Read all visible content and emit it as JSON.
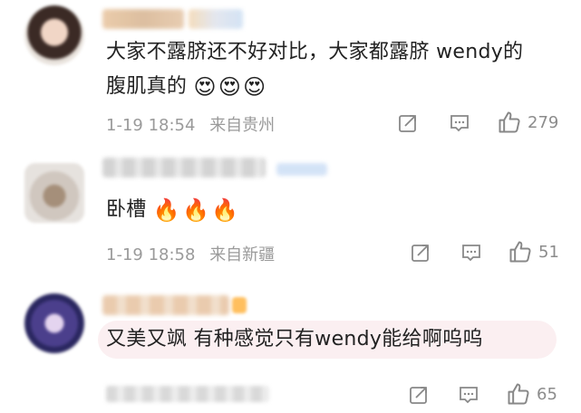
{
  "comments": [
    {
      "text_line1": "大家不露脐还不好对比，大家都露脐 wendy的",
      "text_line2": "腹肌真的",
      "emojis": [
        "😍",
        "😍",
        "😍"
      ],
      "date": "1-19 18:54",
      "location": "来自贵州",
      "likes": "279"
    },
    {
      "text_line1": "卧槽",
      "emojis": [
        "🔥",
        "🔥",
        "🔥"
      ],
      "date": "1-19 18:58",
      "location": "来自新疆",
      "likes": "51"
    },
    {
      "text_line1": "又美又飒 有种感觉只有wendy能给啊呜呜",
      "likes": "65"
    }
  ],
  "icons": {
    "repost": "repost-icon",
    "comment": "comment-icon",
    "like": "thumbs-up-icon"
  },
  "colors": {
    "meta_gray": "#9a9a9a",
    "highlight": "#fbeff1"
  }
}
